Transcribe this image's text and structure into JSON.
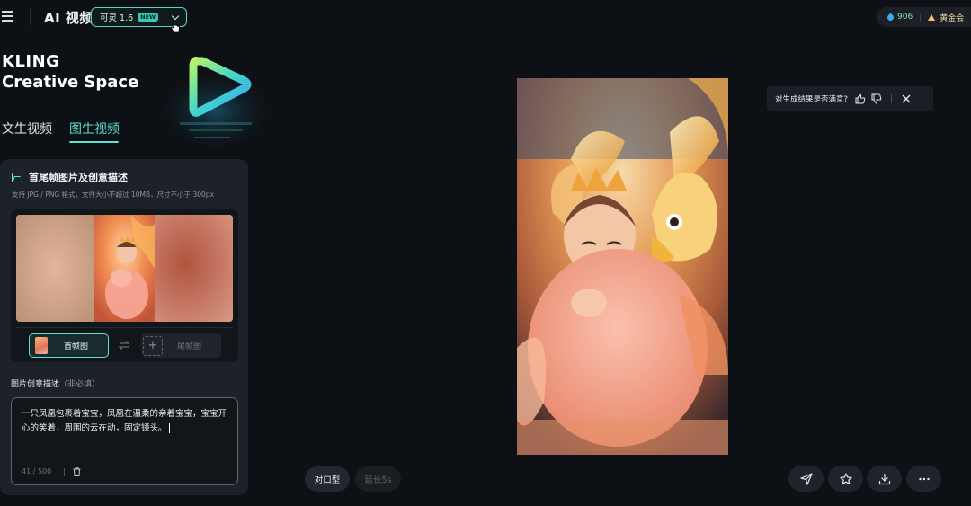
{
  "header": {
    "title": "AI 视频",
    "model": {
      "label": "可灵 1.6",
      "badge": "NEW"
    },
    "credits": {
      "count": "906",
      "member_label": "黄金会"
    }
  },
  "brand": {
    "line1": "KLING",
    "line2": "Creative Space"
  },
  "tabs": [
    {
      "label": "文生视频",
      "active": false
    },
    {
      "label": "图生视频",
      "active": true
    }
  ],
  "panel": {
    "title": "首尾帧图片及创意描述",
    "hint": "支持 JPG / PNG 格式，文件大小不超过 10MB，尺寸不小于 300px",
    "first_frame_label": "首帧图",
    "last_frame_label": "尾帧图",
    "description_label": "图片创意描述",
    "description_optional": "（非必填）",
    "description_text": "一只凤凰包裹着宝宝，凤凰在温柔的亲着宝宝，宝宝开心的笑着，周围的云在动，固定镜头。",
    "char_count": "41 / 500"
  },
  "preview": {
    "feedback_question": "对生成结果是否满意?"
  },
  "bottom_pills": {
    "lip_sync": "对口型",
    "extend": "延长5s"
  },
  "colors": {
    "accent": "#5fe0d0",
    "background": "#0d1014",
    "panel": "#1c2228"
  },
  "icons": [
    "menu-icon",
    "chevron-down-icon",
    "cursor-icon",
    "credits-drop-icon",
    "image-icon",
    "swap-icon",
    "plus-icon",
    "trash-icon",
    "thumbs-up-icon",
    "thumbs-down-icon",
    "close-icon",
    "send-icon",
    "star-icon",
    "download-icon",
    "more-icon"
  ]
}
